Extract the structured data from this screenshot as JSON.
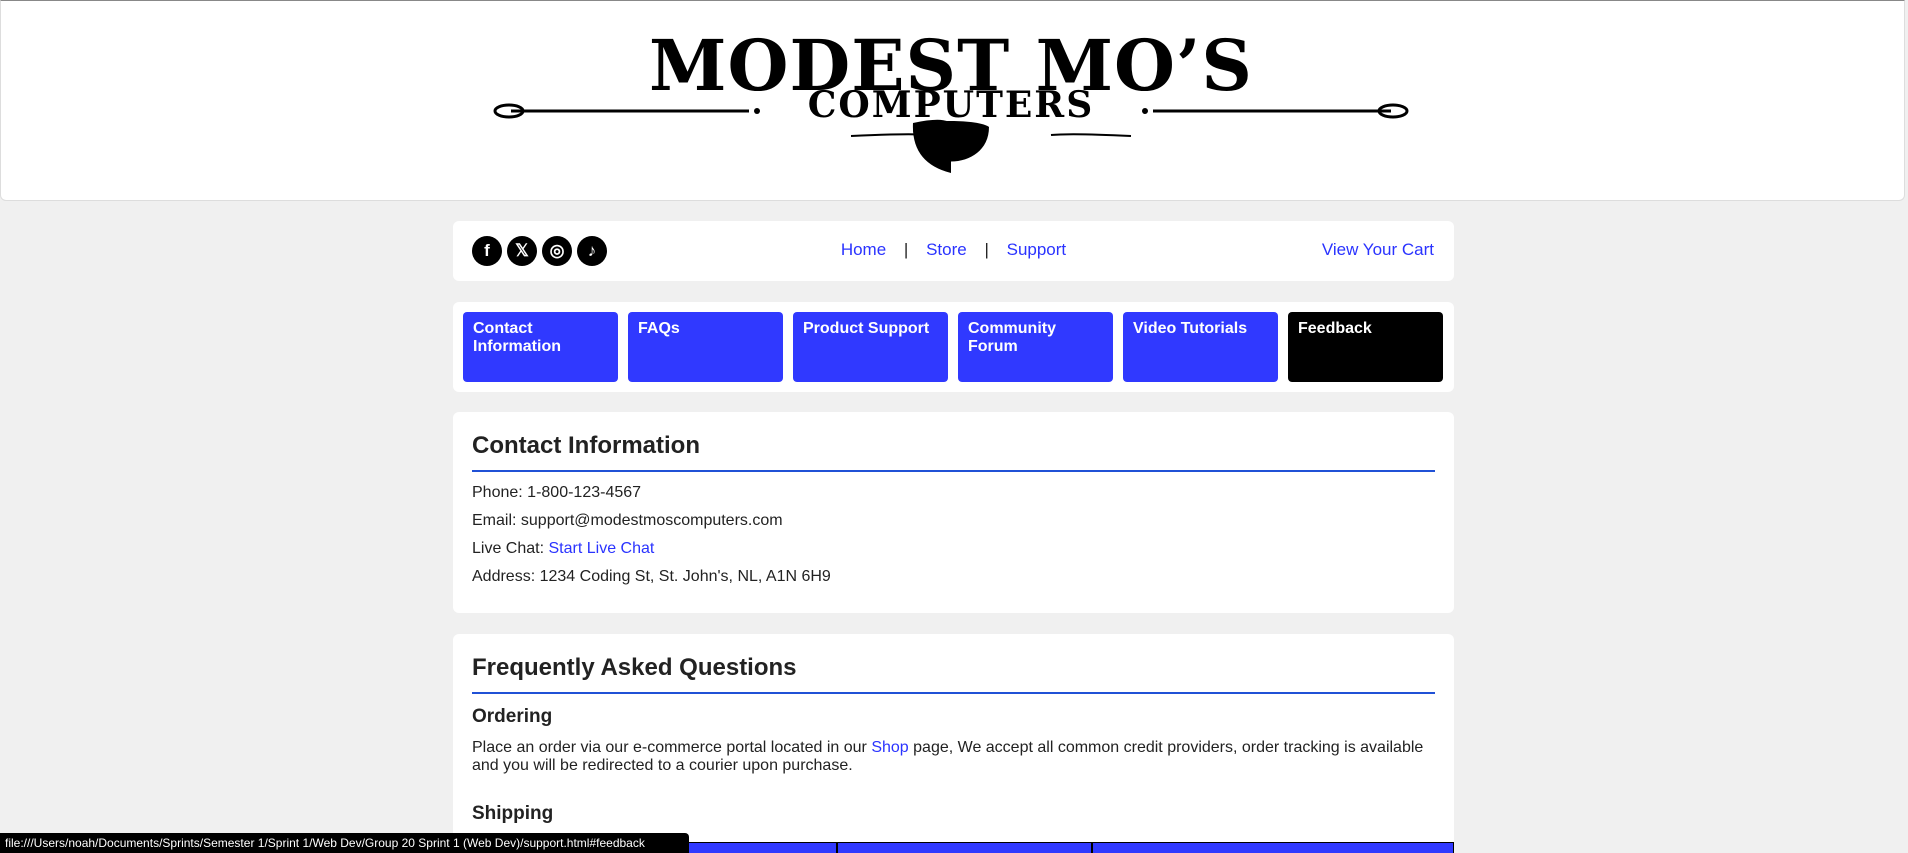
{
  "logo": {
    "title": "MODEST MO’S",
    "subtitle": "COMPUTERS"
  },
  "social": [
    {
      "name": "facebook-icon",
      "glyph": "f"
    },
    {
      "name": "x-icon",
      "glyph": "𝕏"
    },
    {
      "name": "instagram-icon",
      "glyph": "◎"
    },
    {
      "name": "tiktok-icon",
      "glyph": "♪"
    }
  ],
  "nav": {
    "home": "Home",
    "store": "Store",
    "support": "Support",
    "sep": "|",
    "cart": "View Your Cart"
  },
  "tabs": [
    {
      "label": "Contact Information",
      "active": false
    },
    {
      "label": "FAQs",
      "active": false
    },
    {
      "label": "Product Support",
      "active": false
    },
    {
      "label": "Community Forum",
      "active": false
    },
    {
      "label": "Video Tutorials",
      "active": false
    },
    {
      "label": "Feedback",
      "active": true
    }
  ],
  "contact": {
    "heading": "Contact Information",
    "phone_label": "Phone:",
    "phone": "1-800-123-4567",
    "email_label": "Email:",
    "email": "support@modestmoscomputers.com",
    "chat_label": "Live Chat:",
    "chat_link": "Start Live Chat",
    "address_label": "Address:",
    "address": "1234 Coding St, St. John's, NL, A1N 6H9"
  },
  "faq": {
    "heading": "Frequently Asked Questions",
    "ordering_title": "Ordering",
    "ordering_text_1": "Place an order via our e-commerce portal located in our",
    "shop_link": "Shop",
    "ordering_text_2": "page, We accept all common credit providers, order tracking is available and you will be redirected to a courier upon purchase.",
    "shipping_title": "Shipping"
  },
  "status_url": "file:///Users/noah/Documents/Sprints/Semester 1/Sprint 1/Web Dev/Group 20 Sprint 1 (Web Dev)/support.html#feedback",
  "colors": {
    "accent": "#3039ff",
    "link": "#2a33ff",
    "rule": "#2051d6",
    "active_tab": "#000000"
  }
}
